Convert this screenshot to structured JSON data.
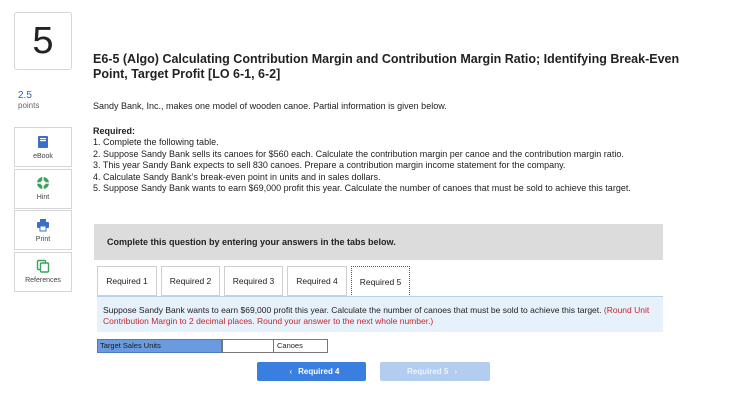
{
  "question": {
    "number": "5",
    "points_value": "2.5",
    "points_label": "points"
  },
  "tools": [
    {
      "label": "eBook",
      "icon": "book-icon"
    },
    {
      "label": "Hint",
      "icon": "lifebuoy-icon"
    },
    {
      "label": "Print",
      "icon": "printer-icon"
    },
    {
      "label": "References",
      "icon": "copy-icon"
    }
  ],
  "title": "E6-5 (Algo) Calculating Contribution Margin and Contribution Margin Ratio; Identifying Break-Even Point, Target Profit [LO 6-1, 6-2]",
  "intro": "Sandy Bank, Inc., makes one model of wooden canoe. Partial information is given below.",
  "required": {
    "heading": "Required:",
    "items": [
      "1. Complete the following table.",
      "2. Suppose Sandy Bank sells its canoes for $560 each. Calculate the contribution margin per canoe and the contribution margin ratio.",
      "3. This year Sandy Bank expects to sell 830 canoes. Prepare a contribution margin income statement for the company.",
      "4. Calculate Sandy Bank’s break-even point in units and in sales dollars.",
      "5. Suppose Sandy Bank wants to earn $69,000 profit this year. Calculate the number of canoes that must be sold to achieve this target."
    ]
  },
  "complete_banner": "Complete this question by entering your answers in the tabs below.",
  "tabs": [
    "Required 1",
    "Required 2",
    "Required 3",
    "Required 4",
    "Required 5"
  ],
  "active_tab": 4,
  "instruction": {
    "text": "Suppose Sandy Bank wants to earn $69,000 profit this year. Calculate the number of canoes that must be sold to achieve this target.",
    "note": "(Round Unit Contribution Margin to 2 decimal places. Round your answer to the next whole number.)"
  },
  "answer_row": {
    "label": "Target Sales Units",
    "value": "",
    "unit": "Canoes"
  },
  "nav": {
    "prev_label": "Required 4",
    "next_label": "Required 5",
    "prev_chev": "‹",
    "next_chev": "›"
  },
  "colors": {
    "accent": "#3a7ee0",
    "note_red": "#c2272d",
    "label_blue": "#6a9be0",
    "instr_bg": "#e7f1fb"
  }
}
